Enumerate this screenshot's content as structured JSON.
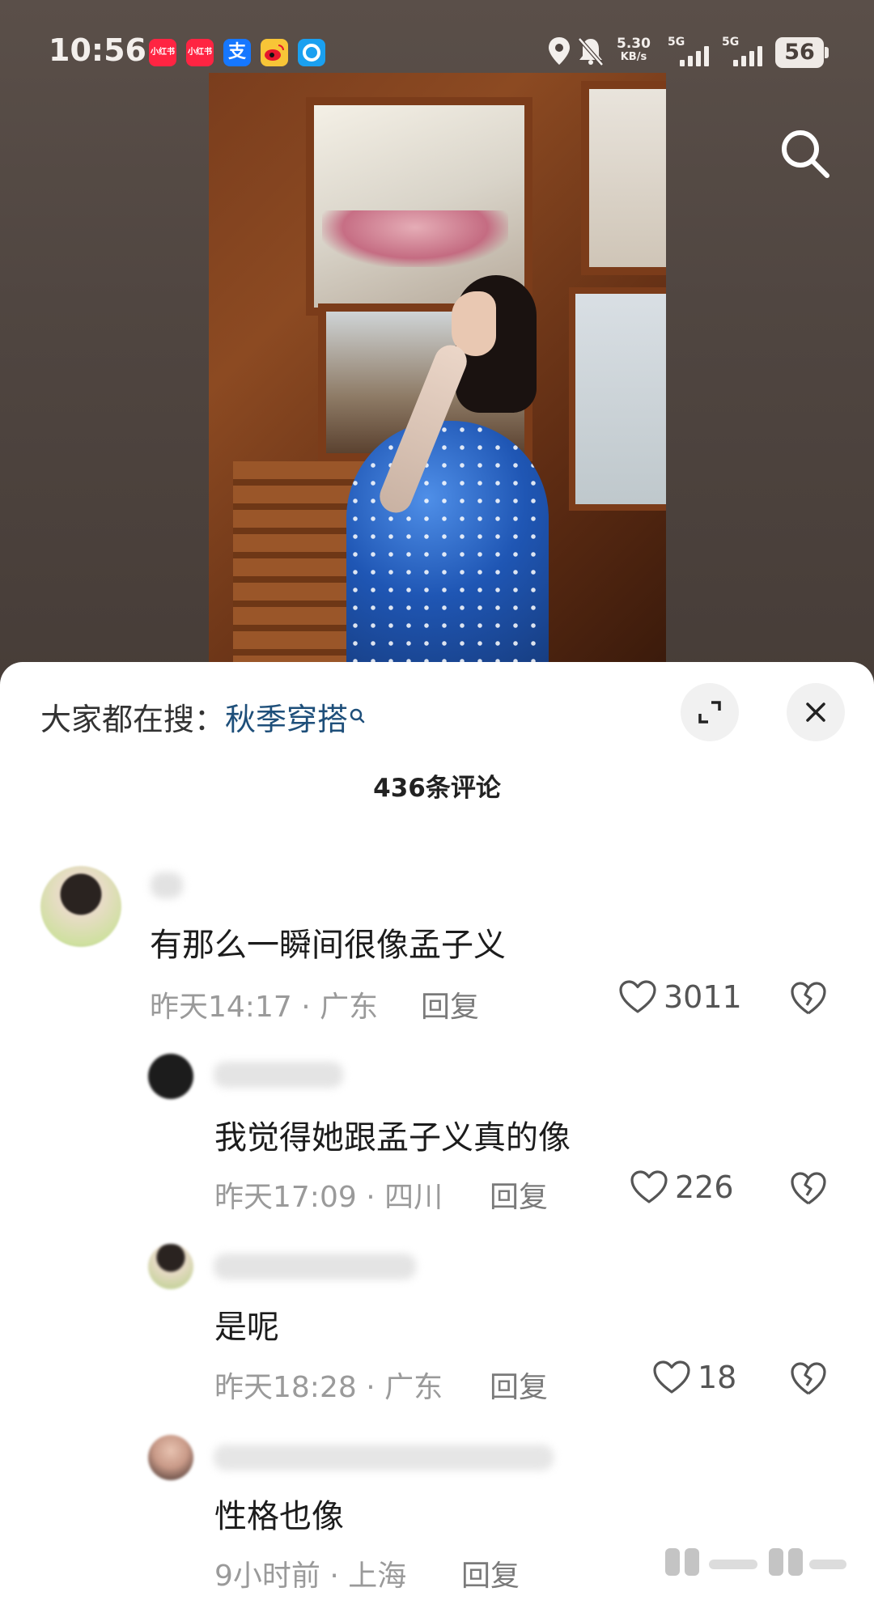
{
  "status_bar": {
    "time": "10:56",
    "app_icons": [
      {
        "name": "xiaohongshu-icon",
        "label": "小红书",
        "color": "#ff2442"
      },
      {
        "name": "xiaohongshu-icon-2",
        "label": "小红书",
        "color": "#ff2442"
      },
      {
        "name": "alipay-icon",
        "label": "支",
        "color": "#1677ff"
      },
      {
        "name": "weibo-icon",
        "label": "",
        "color": "#f8c537"
      },
      {
        "name": "app-icon-blue",
        "label": "",
        "color": "#1aa0f0"
      }
    ],
    "net_speed_value": "5.30",
    "net_speed_unit": "KB/s",
    "signal_1": "5G",
    "signal_2": "5G",
    "battery": "56"
  },
  "sheet": {
    "hot_search_prefix": "大家都在搜：",
    "hot_search_term": "秋季穿搭",
    "comment_count": "436条评论"
  },
  "comments": [
    {
      "text": "有那么一瞬间很像孟子义",
      "meta": "昨天14:17 · 广东",
      "reply": "回复",
      "likes": "3011"
    },
    {
      "text": "我觉得她跟孟子义真的像",
      "meta": "昨天17:09 · 四川",
      "reply": "回复",
      "likes": "226"
    },
    {
      "text": "是呢",
      "meta": "昨天18:28 · 广东",
      "reply": "回复",
      "likes": "18"
    },
    {
      "text": "性格也像",
      "meta": "9小时前 · 上海",
      "reply": "回复",
      "likes": ""
    }
  ],
  "colors": {
    "accent_link": "#1e4f7a",
    "meta_gray": "#9a9a9a"
  }
}
